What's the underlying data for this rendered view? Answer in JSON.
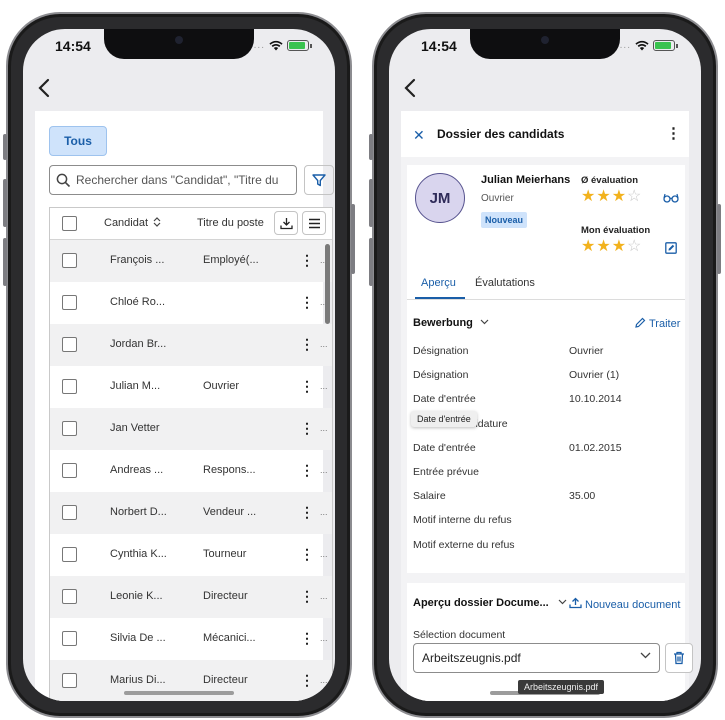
{
  "left_phone": {
    "status": {
      "time": "14:54"
    },
    "filter_chip": "Tous",
    "search": {
      "placeholder": "Rechercher dans \"Candidat\", \"Titre du"
    },
    "table": {
      "columns": [
        "Candidat",
        "Titre du poste"
      ],
      "rows": [
        {
          "candidate": "François ...",
          "title": "Employé(..."
        },
        {
          "candidate": "Chloé Ro...",
          "title": ""
        },
        {
          "candidate": "Jordan Br...",
          "title": ""
        },
        {
          "candidate": "Julian M...",
          "title": "Ouvrier"
        },
        {
          "candidate": "Jan Vetter",
          "title": ""
        },
        {
          "candidate": "Andreas ...",
          "title": "Respons..."
        },
        {
          "candidate": "Norbert D...",
          "title": "Vendeur ..."
        },
        {
          "candidate": "Cynthia K...",
          "title": "Tourneur"
        },
        {
          "candidate": "Leonie K...",
          "title": "Directeur"
        },
        {
          "candidate": "Silvia De ...",
          "title": "Mécanici..."
        },
        {
          "candidate": "Marius Di...",
          "title": "Directeur"
        }
      ],
      "row_ellipsis": "..."
    }
  },
  "right_phone": {
    "status": {
      "time": "14:54"
    },
    "header": {
      "title": "Dossier des candidats"
    },
    "candidate": {
      "initials": "JM",
      "name": "Julian Meierhans",
      "job": "Ouvrier",
      "badge": "Nouveau",
      "avg_rating_label": "Ø évaluation",
      "avg_rating": 3,
      "my_rating_label": "Mon évaluation",
      "my_rating": 3,
      "rating_max": 5
    },
    "tabs": [
      "Aperçu",
      "Évalutations"
    ],
    "active_tab": "Aperçu",
    "section": {
      "title": "Bewerbung",
      "action": "Traiter"
    },
    "fields": [
      {
        "label": "Désignation",
        "value": "Ouvrier"
      },
      {
        "label": "Désignation",
        "value": "Ouvrier (1)"
      },
      {
        "label": "Date d'entrée",
        "value": "10.10.2014"
      },
      {
        "label": "Date de candidature",
        "value": ""
      },
      {
        "label": "Date d'entrée",
        "value": "01.02.2015"
      },
      {
        "label": "Entrée prévue",
        "value": ""
      },
      {
        "label": "Salaire",
        "value": "35.00"
      },
      {
        "label": "Motif interne du refus",
        "value": ""
      },
      {
        "label": "Motif externe du refus",
        "value": ""
      }
    ],
    "tooltip": "Date d'entrée",
    "documents": {
      "title": "Aperçu dossier Docume...",
      "new_doc": "Nouveau document",
      "select_label": "Sélection document",
      "selected": "Arbeitszeugnis.pdf"
    },
    "bottom_tooltip": "Arbeitszeugnis.pdf"
  },
  "colors": {
    "accent": "#1a5ea8",
    "chip_bg": "#cfe3fb",
    "star": "#f2b21d",
    "avatar_bg": "#d9d5ee"
  }
}
